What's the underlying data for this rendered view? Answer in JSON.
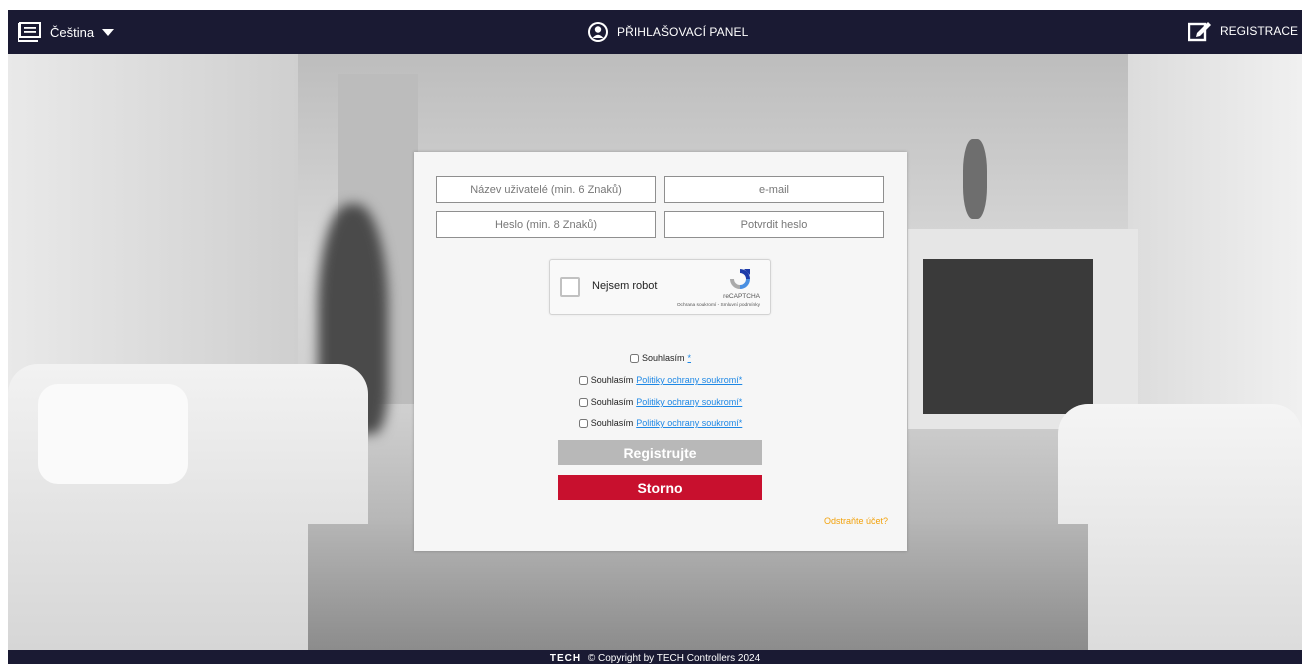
{
  "header": {
    "language_label": "Čeština",
    "title": "PŘIHLAŠOVACÍ PANEL",
    "register_label": "REGISTRACE",
    "bar_color": "#1a1a33"
  },
  "form": {
    "username_placeholder": "Název uživatelé (min. 6 Znaků)",
    "email_placeholder": "e-mail",
    "password_placeholder": "Heslo (min. 8 Znaků)",
    "confirm_placeholder": "Potvrdit heslo",
    "captcha": {
      "label": "Nejsem robot",
      "brand": "reCAPTCHA",
      "terms": "Ochrana soukromí - Smluvní podmínky"
    },
    "consents": [
      {
        "text": "Souhlasím",
        "link": "*"
      },
      {
        "text": "Souhlasím",
        "link": "Politiky ochrany soukromí*"
      },
      {
        "text": "Souhlasím",
        "link": "Politiky ochrany soukromí*"
      },
      {
        "text": "Souhlasím",
        "link": "Politiky ochrany soukromí*"
      }
    ],
    "register_button": "Registrujte",
    "cancel_button": "Storno",
    "remove_account": "Odstraňte účet?",
    "cancel_color": "#c8102e",
    "register_color": "#b8b8b8",
    "link_color": "#1e88e5",
    "remove_color": "#f2a20c"
  },
  "footer": {
    "brand": "TECH",
    "copyright": "© Copyright by TECH Controllers 2024"
  }
}
